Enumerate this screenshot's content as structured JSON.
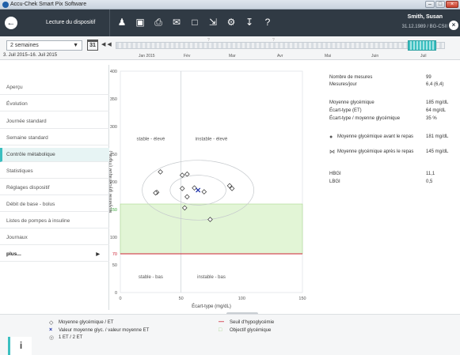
{
  "window": {
    "title": "Accu-Chek Smart Pix Software",
    "controls": [
      "–",
      "□",
      "×"
    ]
  },
  "toolbar": {
    "title": "Lecture du dispositif",
    "icons": [
      "people-icon",
      "save-icon",
      "print-icon",
      "mail-icon",
      "pdf-icon",
      "export-icon",
      "settings-icon",
      "import-icon",
      "help-icon"
    ],
    "patient_name": "Smith, Susan",
    "patient_id": "31.12.1989 / BG-CSII"
  },
  "range": {
    "period_value": "2 semaines",
    "calendar_day": "31",
    "date_range": "3. Juil 2015–16. Juil 2015",
    "months": [
      "Jan 2015",
      "Fév",
      "Mar",
      "Avr",
      "Mai",
      "Juin",
      "Juil"
    ]
  },
  "sidebar": {
    "items": [
      {
        "label": "Aperçu"
      },
      {
        "label": "Évolution"
      },
      {
        "label": "Journée standard"
      },
      {
        "label": "Semaine standard"
      },
      {
        "label": "Contrôle métabolique"
      },
      {
        "label": "Statistiques"
      },
      {
        "label": "Réglages dispositif"
      },
      {
        "label": "Débit de base - bolus"
      },
      {
        "label": "Listes de pompes à insuline"
      },
      {
        "label": "Journaux"
      },
      {
        "label": "plus..."
      }
    ],
    "active_index": 4
  },
  "chart_data": {
    "type": "scatter",
    "xlabel": "Écart-type (mg/dL)",
    "ylabel": "Moyenne glycémique (mg/dL)",
    "xlim": [
      0,
      150
    ],
    "ylim": [
      0,
      400
    ],
    "x_ticks": [
      0,
      50,
      100,
      150
    ],
    "y_ticks": [
      50,
      100,
      150,
      200,
      250,
      300,
      350,
      400
    ],
    "target_range": [
      70,
      160
    ],
    "hypo_threshold": 70,
    "quadrant_x": 50,
    "quadrant_y": 150,
    "quadrant_labels": [
      "stable - élevé",
      "instable - élevé",
      "stable - bas",
      "instable - bas"
    ],
    "points": [
      {
        "x": 33,
        "y": 218
      },
      {
        "x": 30,
        "y": 181
      },
      {
        "x": 29,
        "y": 180
      },
      {
        "x": 51,
        "y": 212
      },
      {
        "x": 55,
        "y": 214
      },
      {
        "x": 51,
        "y": 188
      },
      {
        "x": 55,
        "y": 173
      },
      {
        "x": 53,
        "y": 153
      },
      {
        "x": 61,
        "y": 189
      },
      {
        "x": 69,
        "y": 182
      },
      {
        "x": 90,
        "y": 193
      },
      {
        "x": 92,
        "y": 188
      },
      {
        "x": 74,
        "y": 132
      }
    ],
    "mean_point": {
      "x": 64,
      "y": 185
    },
    "ellipses": [
      {
        "label": "1 ET",
        "sd_x": 23,
        "sd_y": 27
      },
      {
        "label": "2 ET",
        "sd_x": 46,
        "sd_y": 54
      }
    ],
    "colors": {
      "hypo_line": "#cc2233",
      "target_band": "#e2f5d6",
      "target_border": "#9dd07f",
      "mean_marker": "#1a2ea8",
      "grid": "#d8dcdf"
    }
  },
  "stats": [
    {
      "label": "Nombre de mesures",
      "value": "99"
    },
    {
      "label": "Mesures/jour",
      "value": "6,4 (6,4)"
    },
    {
      "label": "Moyenne glycémique",
      "value": "185 mg/dL"
    },
    {
      "label": "Écart-type (ET)",
      "value": "64 mg/dL"
    },
    {
      "label": "Écart-type / moyenne glycémique",
      "value": "35 %"
    },
    {
      "label": "Moyenne glycémique avant le repas",
      "value": "181 mg/dL",
      "icon": "apple-icon"
    },
    {
      "label": "Moyenne glycémique après le repas",
      "value": "145 mg/dL",
      "icon": "apple-core-icon"
    },
    {
      "label": "HBGI",
      "value": "11,1"
    },
    {
      "label": "LBGI",
      "value": "0,5"
    }
  ],
  "legend": {
    "items": [
      {
        "symbol": "◇",
        "label": "Moyenne glycémique / ET"
      },
      {
        "symbol": "×",
        "label": "Valeur moyenne glyc. / valeur moyenne ET"
      },
      {
        "symbol": "◎",
        "label": "1 ET / 2 ET"
      },
      {
        "symbol": "—",
        "label": "Seuil d'hypoglycémie"
      },
      {
        "symbol": "□",
        "label": "Objectif glycémique"
      }
    ],
    "info_label": "i"
  }
}
